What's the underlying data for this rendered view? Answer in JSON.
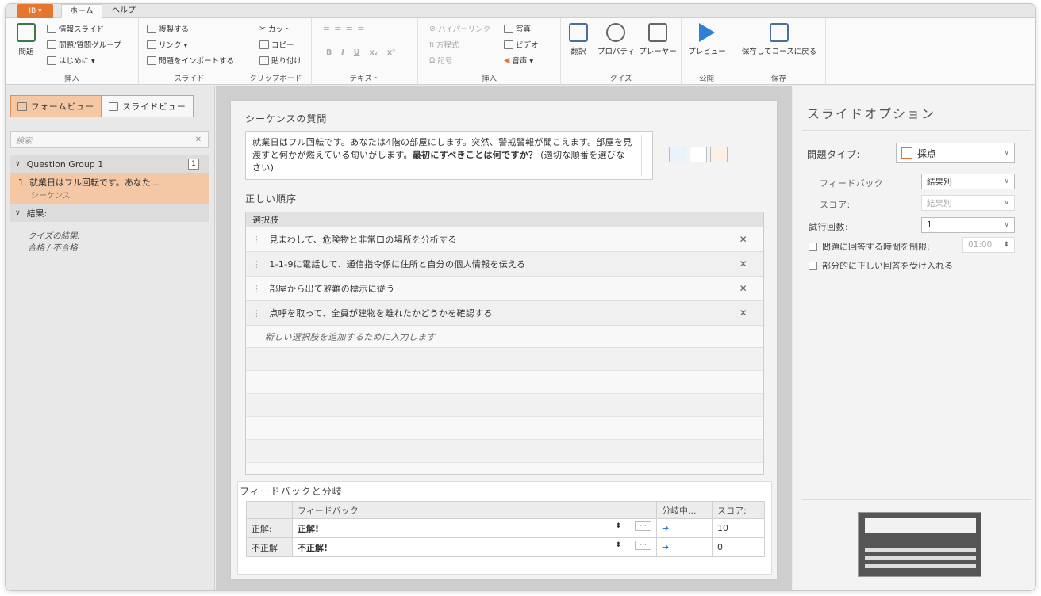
{
  "tabs": {
    "app": "IB ▾",
    "home": "ホーム",
    "help": "ヘルプ"
  },
  "ribbon": {
    "insert": {
      "question": "問題",
      "info_slide": "情報スライド",
      "group": "問題/質問グループ",
      "intro": "はじめに ▾",
      "label": "挿入"
    },
    "slide": {
      "duplicate": "複製する",
      "link": "リンク ▾",
      "import": "問題をインポートする",
      "label": "スライド"
    },
    "clipboard": {
      "cut": "カット",
      "copy": "コピー",
      "paste": "貼り付け",
      "label": "クリップボード"
    },
    "text": {
      "label": "テキスト",
      "bold": "B",
      "italic": "I",
      "underline": "U",
      "sub": "x₂",
      "sup": "x²"
    },
    "insert2": {
      "hyperlink": "ハイパーリンク",
      "equation": "方程式",
      "symbol": "記号",
      "photo": "写真",
      "video": "ビデオ",
      "audio": "音声 ▾",
      "label": "挿入"
    },
    "quiz": {
      "translate": "翻訳",
      "properties": "プロパティ",
      "player": "プレーヤー",
      "label": "クイズ"
    },
    "publish": {
      "preview": "プレビュー",
      "label": "公開"
    },
    "save": {
      "save_return": "保存してコースに戻る",
      "label": "保存"
    }
  },
  "left": {
    "form_view": "フォームビュー",
    "slide_view": "スライドビュー",
    "search_placeholder": "検索",
    "group": "Question Group 1",
    "group_count": "1",
    "item_title": "1. 就業日はフル回転です。あなた...",
    "item_type": "シーケンス",
    "results": "結果:",
    "results_title": "クイズの結果:",
    "results_sub": "合格 / 不合格"
  },
  "center": {
    "heading": "シーケンスの質問",
    "question_plain": "就業日はフル回転です。あなたは4階の部屋にします。突然、警戒警報が聞こえます。部屋を見渡すと何かが燃えている匂いがします。",
    "question_bold": "最初にすべきことは何ですか？",
    "question_hint": "(適切な順番を選びなさい)",
    "order_heading": "正しい順序",
    "choices_header": "選択肢",
    "choices": [
      "見まわして、危険物と非常口の場所を分析する",
      "1-1-9に電話して、通信指令係に住所と自分の個人情報を伝える",
      "部屋から出て避難の標示に従う",
      "点呼を取って、全員が建物を離れたかどうかを確認する"
    ],
    "add_placeholder": "新しい選択肢を追加するために入力します",
    "feedback_heading": "フィードバックと分岐",
    "fb_cols": {
      "feedback": "フィードバック",
      "branch": "分岐中...",
      "score": "スコア:"
    },
    "fb_rows": [
      {
        "label": "正解:",
        "text": "正解!",
        "score": "10"
      },
      {
        "label": "不正解",
        "text": "不正解!",
        "score": "0"
      }
    ]
  },
  "right": {
    "title": "スライドオプション",
    "qtype_label": "問題タイプ:",
    "qtype": "採点",
    "feedback_label": "フィードバック",
    "feedback": "結果別",
    "score_label": "スコア:",
    "score": "結果別",
    "attempts_label": "試行回数:",
    "attempts": "1",
    "time_limit": "問題に回答する時間を制限:",
    "time_value": "01:00",
    "partial": "部分的に正しい回答を受け入れる"
  }
}
